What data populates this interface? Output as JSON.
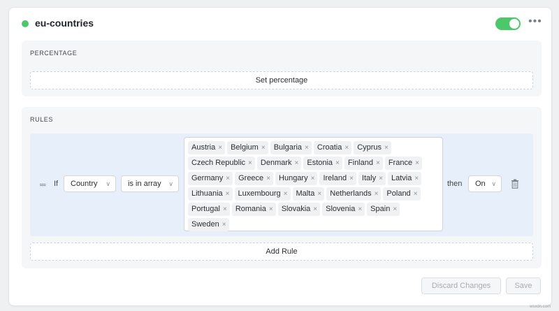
{
  "flag": {
    "name": "eu-countries",
    "enabled": true,
    "status_color": "#4cc76a"
  },
  "percentage": {
    "label": "PERCENTAGE",
    "set_label": "Set percentage"
  },
  "rules": {
    "label": "RULES",
    "if_label": "If",
    "attribute": "Country",
    "operator": "is in array",
    "then_label": "then",
    "result": "On",
    "values": [
      "Austria",
      "Belgium",
      "Bulgaria",
      "Croatia",
      "Cyprus",
      "Czech Republic",
      "Denmark",
      "Estonia",
      "Finland",
      "France",
      "Germany",
      "Greece",
      "Hungary",
      "Ireland",
      "Italy",
      "Latvia",
      "Lithuania",
      "Luxembourg",
      "Malta",
      "Netherlands",
      "Poland",
      "Portugal",
      "Romania",
      "Slovakia",
      "Slovenia",
      "Spain",
      "Sweden"
    ],
    "remove_glyph": "×",
    "add_rule_label": "Add Rule"
  },
  "footer": {
    "discard_label": "Discard Changes",
    "save_label": "Save"
  },
  "watermark": "wsxdn.com"
}
